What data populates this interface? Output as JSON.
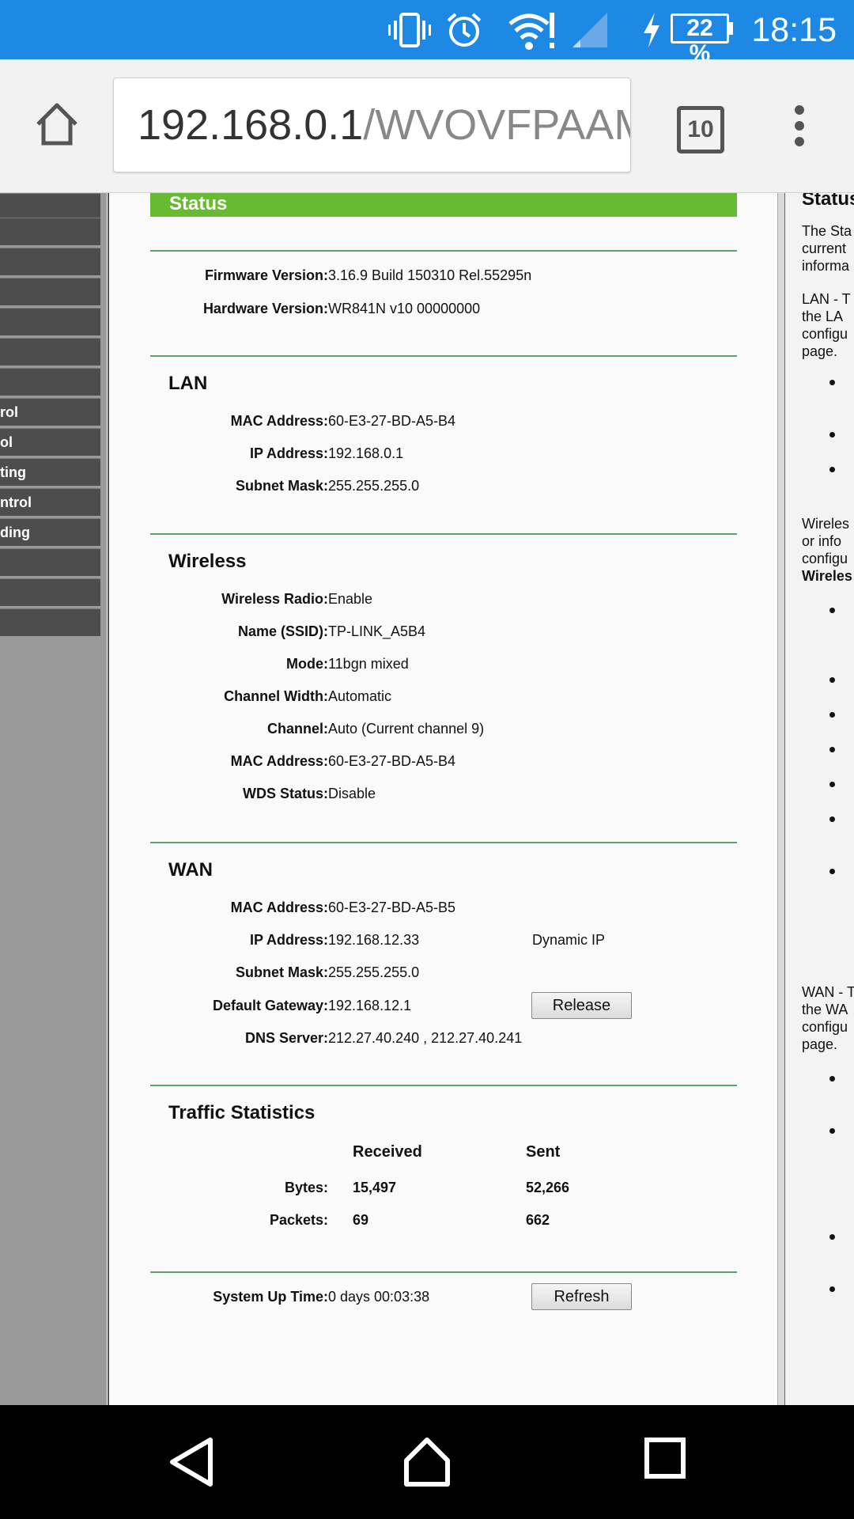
{
  "status_bar": {
    "battery": "22 %",
    "time": "18:15",
    "icons": [
      "vibrate-icon",
      "alarm-icon",
      "wifi-alert-icon",
      "signal-icon",
      "charging-icon",
      "battery-icon"
    ]
  },
  "browser": {
    "url_host": "192.168.0.1",
    "url_path": "/WVOVFPAAM",
    "tab_count": "10",
    "icons": [
      "home-icon",
      "tabs-icon",
      "menu-icon"
    ]
  },
  "left_menu": {
    "items": [
      "",
      "",
      "",
      "",
      "",
      "",
      "rol",
      "ol",
      "ting",
      "ntrol",
      "ding",
      "",
      "",
      ""
    ]
  },
  "status_section": {
    "title": "Status",
    "firmware_label": "Firmware Version:",
    "firmware_value": "3.16.9 Build 150310 Rel.55295n",
    "hardware_label": "Hardware Version:",
    "hardware_value": "WR841N v10 00000000"
  },
  "lan": {
    "title": "LAN",
    "mac_label": "MAC Address:",
    "mac_value": "60-E3-27-BD-A5-B4",
    "ip_label": "IP Address:",
    "ip_value": "192.168.0.1",
    "mask_label": "Subnet Mask:",
    "mask_value": "255.255.255.0"
  },
  "wireless": {
    "title": "Wireless",
    "radio_label": "Wireless Radio:",
    "radio_value": "Enable",
    "ssid_label": "Name (SSID):",
    "ssid_value": "TP-LINK_A5B4",
    "mode_label": "Mode:",
    "mode_value": "11bgn mixed",
    "width_label": "Channel Width:",
    "width_value": "Automatic",
    "channel_label": "Channel:",
    "channel_value": "Auto (Current channel 9)",
    "mac_label": "MAC Address:",
    "mac_value": "60-E3-27-BD-A5-B4",
    "wds_label": "WDS Status:",
    "wds_value": "Disable"
  },
  "wan": {
    "title": "WAN",
    "mac_label": "MAC Address:",
    "mac_value": "60-E3-27-BD-A5-B5",
    "ip_label": "IP Address:",
    "ip_value": "192.168.12.33",
    "ip_type": "Dynamic IP",
    "mask_label": "Subnet Mask:",
    "mask_value": "255.255.255.0",
    "gateway_label": "Default Gateway:",
    "gateway_value": "192.168.12.1",
    "release_button": "Release",
    "dns_label": "DNS Server:",
    "dns_value": "212.27.40.240 , 212.27.40.241"
  },
  "traffic": {
    "title": "Traffic Statistics",
    "received_header": "Received",
    "sent_header": "Sent",
    "bytes_label": "Bytes:",
    "bytes_received": "15,497",
    "bytes_sent": "52,266",
    "packets_label": "Packets:",
    "packets_received": "69",
    "packets_sent": "662"
  },
  "uptime": {
    "label": "System Up Time:",
    "value": "0 days 00:03:38",
    "refresh_button": "Refresh"
  },
  "help": {
    "title": "Status",
    "lines": [
      "The Sta",
      "current",
      "informa",
      "LAN - T",
      "the LA",
      "configu",
      "page.",
      "Wireles",
      "or info",
      "configu",
      "Wireles",
      "WAN - T",
      "the WA",
      "configu",
      "page."
    ]
  },
  "nav_bar": {
    "icons": [
      "back-icon",
      "home-icon",
      "recents-icon"
    ]
  }
}
